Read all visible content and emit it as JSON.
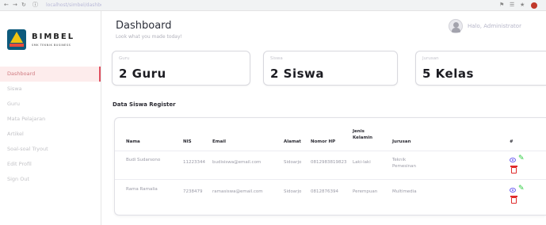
{
  "browser": {
    "url": "localhost/simbel/dashboard"
  },
  "sidebar": {
    "logo_name": "BIMBEL",
    "logo_tagline": "SMK TEKNIK BUSINESS",
    "items": [
      {
        "label": "Dashboard",
        "active": true
      },
      {
        "label": "Siswa",
        "active": false
      },
      {
        "label": "Guru",
        "active": false
      },
      {
        "label": "Mata Pelajaran",
        "active": false
      },
      {
        "label": "Artikel",
        "active": false
      },
      {
        "label": "Soal-soal Tryout",
        "active": false
      },
      {
        "label": "Edit Profil",
        "active": false
      },
      {
        "label": "Sign Out",
        "active": false
      }
    ]
  },
  "header": {
    "title": "Dashboard",
    "subtitle": "Look what you made today!",
    "greeting": "Halo, Administrator"
  },
  "stats": [
    {
      "label": "Guru",
      "value": "2 Guru"
    },
    {
      "label": "Siswa",
      "value": "2 Siswa"
    },
    {
      "label": "Jurusan",
      "value": "5 Kelas"
    }
  ],
  "students": {
    "title": "Data Siswa Register",
    "columns": [
      "Nama",
      "NIS",
      "Email",
      "Alamat",
      "Nomor HP",
      "Jenis Kelamin",
      "Jurusan",
      "#"
    ],
    "rows": [
      {
        "nama": "Budi Sudarsono",
        "nis": "11223344",
        "email": "budisiswa@email.com",
        "alamat": "Sidoarjo",
        "hp": "0812983819823",
        "jk": "Laki-laki",
        "jurusan": "Teknik Pemesinan"
      },
      {
        "nama": "Rama Ramalia",
        "nis": "7238479",
        "email": "ramasiswa@email.com",
        "alamat": "Sidoarjo",
        "hp": "0812876394",
        "jk": "Perempuan",
        "jurusan": "Multimedia"
      }
    ]
  },
  "colors": {
    "accent": "#e05060",
    "active_bg": "#fdecec",
    "view_icon": "#6b5cf0",
    "edit_icon": "#2ecc40",
    "delete_icon": "#e02b2b"
  }
}
